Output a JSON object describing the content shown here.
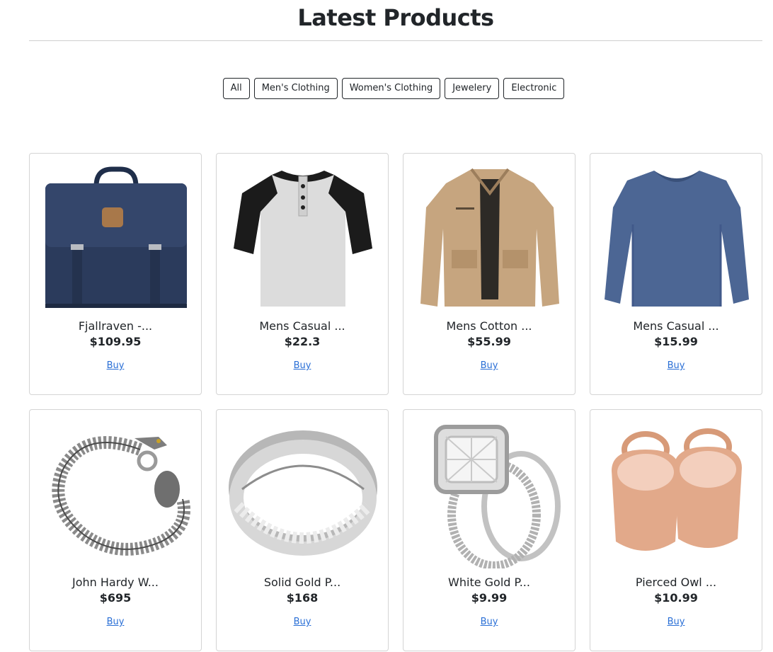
{
  "page": {
    "title": "Latest Products"
  },
  "filters": [
    {
      "label": "All"
    },
    {
      "label": "Men's Clothing"
    },
    {
      "label": "Women's Clothing"
    },
    {
      "label": "Jewelery"
    },
    {
      "label": "Electronic"
    }
  ],
  "products": [
    {
      "title": "Fjallraven -...",
      "price": "$109.95",
      "buy_label": "Buy",
      "image_icon": "backpack-image"
    },
    {
      "title": "Mens Casual ...",
      "price": "$22.3",
      "buy_label": "Buy",
      "image_icon": "raglan-tshirt-image"
    },
    {
      "title": "Mens Cotton ...",
      "price": "$55.99",
      "buy_label": "Buy",
      "image_icon": "cotton-jacket-image"
    },
    {
      "title": "Mens Casual ...",
      "price": "$15.99",
      "buy_label": "Buy",
      "image_icon": "long-sleeve-shirt-image"
    },
    {
      "title": "John Hardy W...",
      "price": "$695",
      "buy_label": "Buy",
      "image_icon": "dragon-bracelet-image"
    },
    {
      "title": "Solid Gold P...",
      "price": "$168",
      "buy_label": "Buy",
      "image_icon": "silver-band-ring-image"
    },
    {
      "title": "White Gold P...",
      "price": "$9.99",
      "buy_label": "Buy",
      "image_icon": "diamond-ring-image"
    },
    {
      "title": "Pierced Owl ...",
      "price": "$10.99",
      "buy_label": "Buy",
      "image_icon": "rose-gold-tunnel-plugs-image"
    }
  ],
  "colors": {
    "link": "#2a6fd6",
    "text": "#212529",
    "border": "#d4d4d4"
  }
}
